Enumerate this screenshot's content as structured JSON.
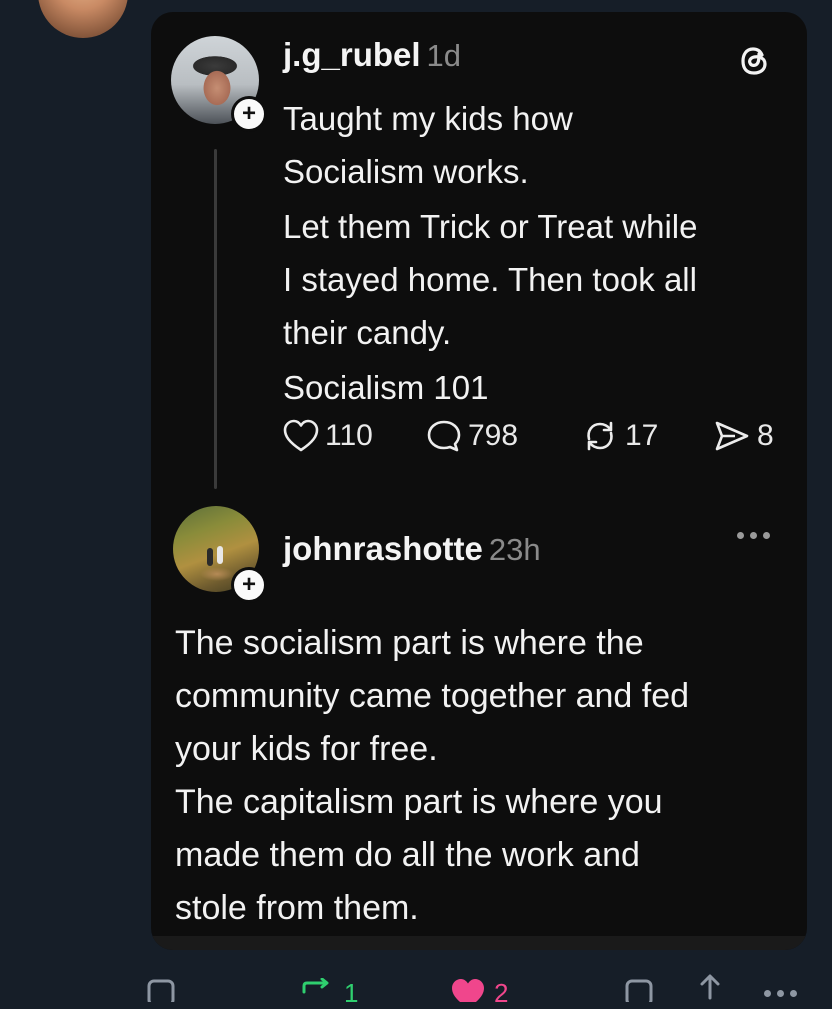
{
  "post": {
    "username": "j.g_rubel",
    "time": "1d",
    "lines": [
      "Taught my kids how",
      "Socialism works.",
      "Let them Trick or Treat while",
      "I stayed home. Then took all",
      "their candy.",
      "Socialism 101"
    ],
    "likes": "110",
    "replies": "798",
    "reposts": "17",
    "shares": "8"
  },
  "reply": {
    "username": "johnrashotte",
    "time": "23h",
    "lines": [
      "The socialism part is where the",
      "community came together and fed",
      "your kids for free.",
      "The capitalism part is where you",
      "made them do all the work and",
      "stole from them."
    ]
  },
  "bottom_bar": {
    "repost_count": "1",
    "like_count": "2"
  },
  "colors": {
    "page_bg": "#161e28",
    "card_bg": "#0d0d0d",
    "repost_green": "#2fcf6f",
    "like_pink": "#f0468c"
  }
}
